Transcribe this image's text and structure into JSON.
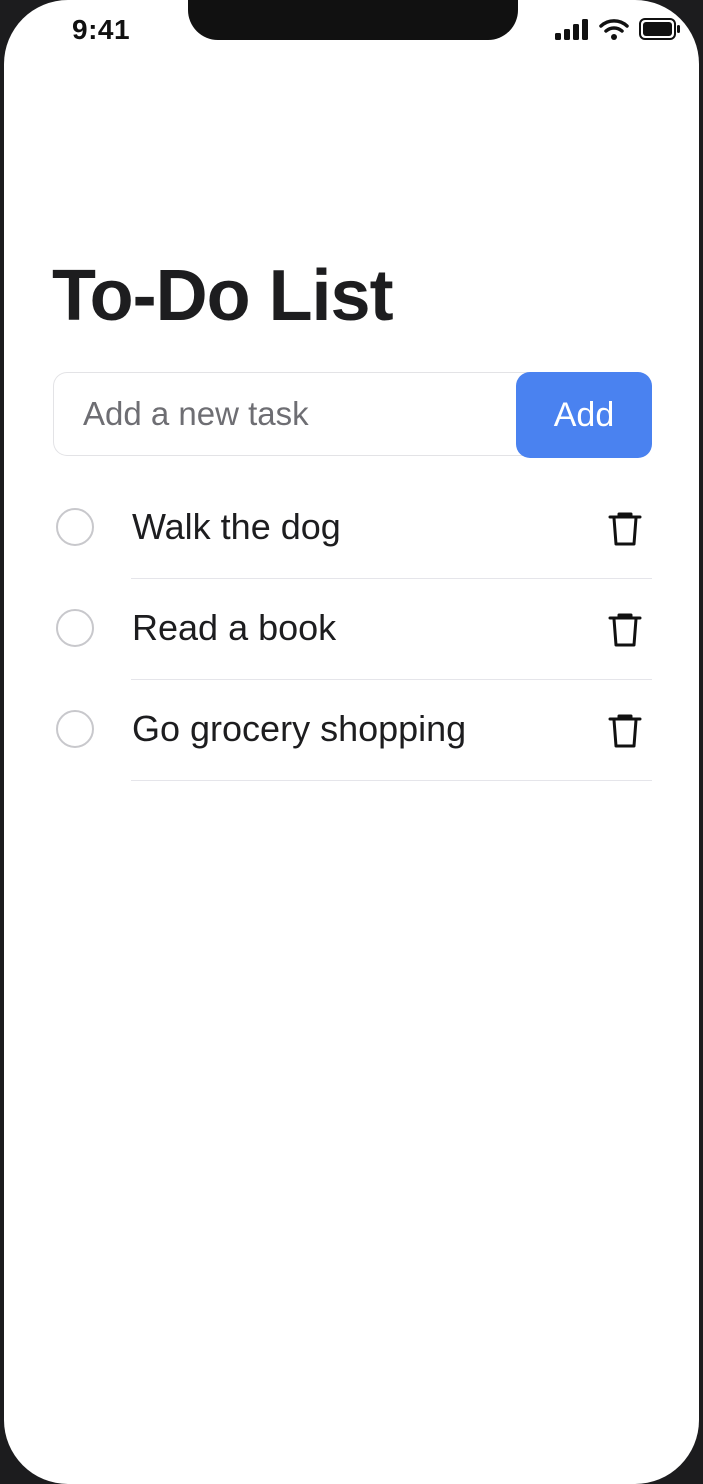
{
  "status_bar": {
    "time": "9:41",
    "icons": [
      "cellular-signal-icon",
      "wifi-icon",
      "battery-icon"
    ]
  },
  "app": {
    "title": "To-Do List"
  },
  "new_task": {
    "value": "",
    "placeholder": "Add a new task",
    "add_label": "Add"
  },
  "tasks": [
    {
      "label": "Walk the dog",
      "completed": false,
      "delete_icon": "trash-icon"
    },
    {
      "label": "Read a book",
      "completed": false,
      "delete_icon": "trash-icon"
    },
    {
      "label": "Go grocery shopping",
      "completed": false,
      "delete_icon": "trash-icon"
    }
  ],
  "colors": {
    "accent": "#4a82f0",
    "text": "#1d1d1f",
    "placeholder": "#6e6e73",
    "checkbox_border": "#c8c8cc",
    "separator": "#e5e5ea"
  }
}
